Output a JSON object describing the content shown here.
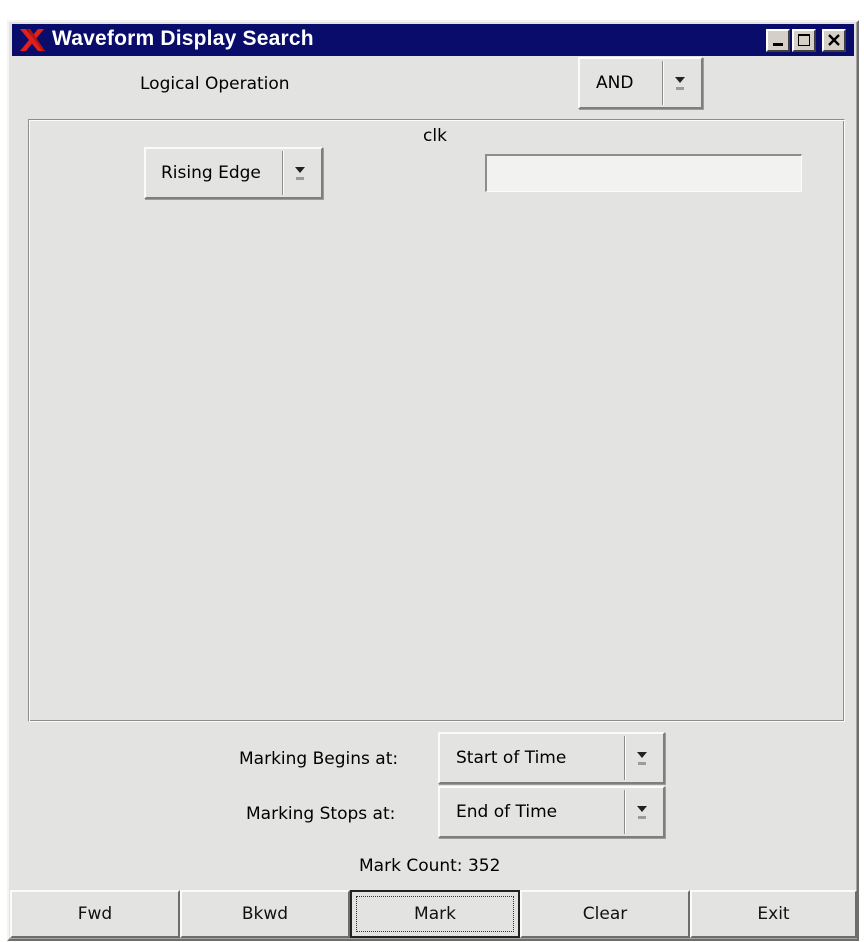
{
  "window": {
    "title": "Waveform Display Search",
    "title_bar_color": "#0a0c6b",
    "background_color": "#e3e4e1",
    "logo_icon": "x-logo-icon",
    "controls": [
      {
        "name": "minimize",
        "icon": "minimize-icon"
      },
      {
        "name": "maximize",
        "icon": "maximize-icon"
      },
      {
        "name": "close",
        "icon": "close-icon"
      }
    ]
  },
  "logical_operation": {
    "label": "Logical Operation",
    "selected": "AND"
  },
  "signal": {
    "name": "clk",
    "condition_selected": "Rising Edge",
    "value_input": ""
  },
  "marking": {
    "begins_label": "Marking Begins at:",
    "begins_selected": "Start of Time",
    "stops_label": "Marking Stops at:",
    "stops_selected": "End of Time"
  },
  "mark_count": "Mark Count: 352",
  "buttons": {
    "fwd": "Fwd",
    "bkwd": "Bkwd",
    "mark": "Mark",
    "clear": "Clear",
    "exit": "Exit"
  }
}
